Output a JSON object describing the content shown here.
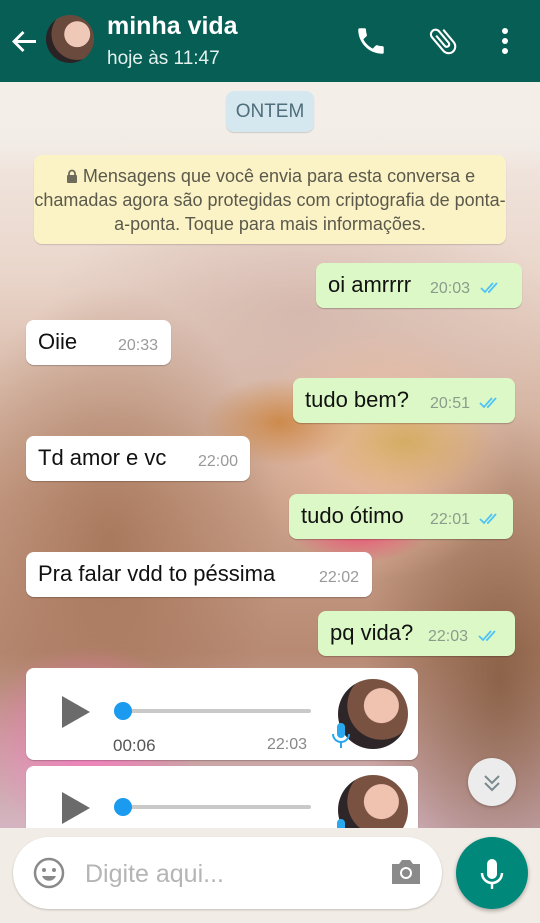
{
  "header": {
    "contact_name": "minha vida",
    "last_seen": "hoje às 11:47",
    "icons": [
      "back-arrow-icon",
      "phone-icon",
      "paperclip-icon",
      "more-vertical-icon"
    ]
  },
  "chat": {
    "date_chip": "ONTEM",
    "encryption_notice": "Mensagens que você envia para esta conversa e chamadas agora são protegidas com criptografia de ponta-a-ponta. Toque para mais informações.",
    "messages": [
      {
        "direction": "out",
        "text": "oi amrrrr",
        "time": "20:03",
        "status": "read"
      },
      {
        "direction": "in",
        "text": "Oiie ",
        "time": "20:33"
      },
      {
        "direction": "out",
        "text": "tudo bem?",
        "time": "20:51",
        "status": "read"
      },
      {
        "direction": "in",
        "text": "Td amor e vc",
        "time": "22:00"
      },
      {
        "direction": "out",
        "text": "tudo ótimo",
        "time": "22:01",
        "status": "read"
      },
      {
        "direction": "in",
        "text": "Pra falar vdd to péssima",
        "time": "22:02"
      },
      {
        "direction": "out",
        "text": "pq vida?",
        "time": "22:03",
        "status": "read"
      }
    ],
    "voice_messages": [
      {
        "duration": "00:06",
        "time": "22:03",
        "progress": 0
      },
      {
        "duration": "",
        "time": "",
        "progress": 0
      }
    ]
  },
  "composer": {
    "placeholder": "Digite aqui...",
    "icons": [
      "emoji-icon",
      "camera-icon",
      "mic-icon"
    ]
  },
  "colors": {
    "header": "#075e54",
    "outgoing_bubble": "#dcf8c6",
    "incoming_bubble": "#ffffff",
    "read_ticks": "#4fc3f7",
    "mic_button": "#00897b"
  }
}
